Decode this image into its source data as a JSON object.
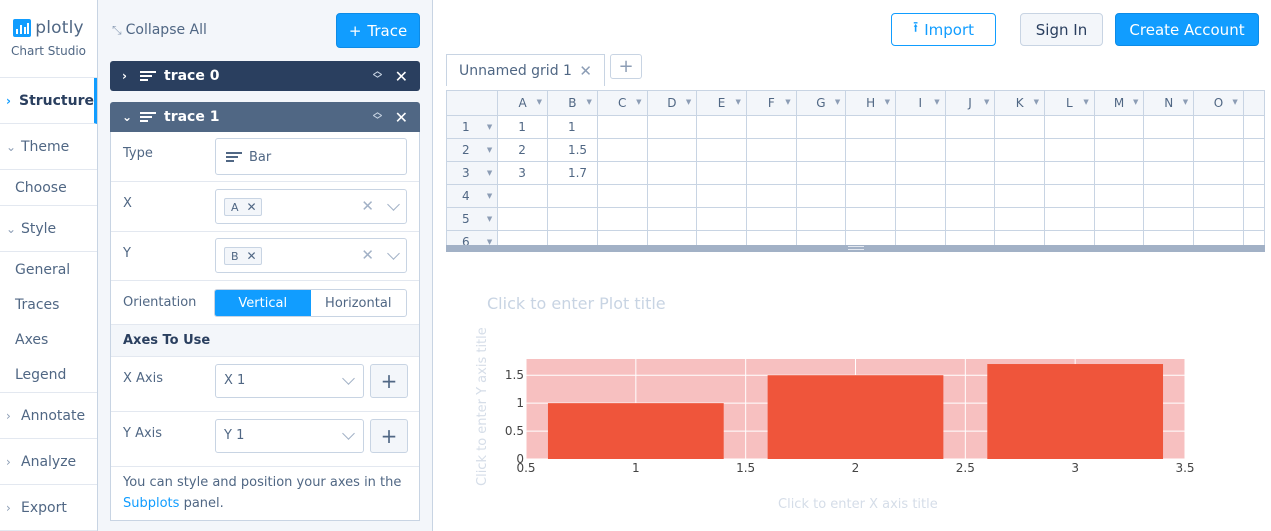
{
  "app": {
    "logo_text": "plotly",
    "logo_sub": "Chart Studio"
  },
  "sidebar": {
    "sections": [
      {
        "label": "Structure",
        "chevron": "›",
        "active": true
      },
      {
        "label": "Theme",
        "chevron": "⌄",
        "sub": [
          "Choose"
        ]
      },
      {
        "label": "Style",
        "chevron": "⌄",
        "sub": [
          "General",
          "Traces",
          "Axes",
          "Legend"
        ]
      },
      {
        "label": "Annotate",
        "chevron": "›"
      },
      {
        "label": "Analyze",
        "chevron": "›"
      },
      {
        "label": "Export",
        "chevron": "›"
      }
    ]
  },
  "panel": {
    "collapse_all": "Collapse All",
    "add_trace": "Trace",
    "trace0": {
      "name": "trace 0"
    },
    "trace1": {
      "name": "trace 1",
      "type_label": "Type",
      "type_value": "Bar",
      "x_label": "X",
      "x_chip": "A",
      "y_label": "Y",
      "y_chip": "B",
      "orientation_label": "Orientation",
      "orientation_options": [
        "Vertical",
        "Horizontal"
      ],
      "orientation_selected": "Vertical",
      "axes_section": "Axes To Use",
      "x_axis_label": "X Axis",
      "x_axis_value": "X 1",
      "y_axis_label": "Y Axis",
      "y_axis_value": "Y 1",
      "help_prefix": "You can style and position your axes in the",
      "help_link": "Subplots",
      "help_suffix": "panel."
    }
  },
  "topbar": {
    "import": "Import",
    "sign_in": "Sign In",
    "create_account": "Create Account"
  },
  "grid": {
    "tab_name": "Unnamed grid 1",
    "columns": [
      "A",
      "B",
      "C",
      "D",
      "E",
      "F",
      "G",
      "H",
      "I",
      "J",
      "K",
      "L",
      "M",
      "N",
      "O"
    ],
    "rows": [
      {
        "n": "1",
        "cells": [
          "1",
          "1"
        ]
      },
      {
        "n": "2",
        "cells": [
          "2",
          "1.5"
        ]
      },
      {
        "n": "3",
        "cells": [
          "3",
          "1.7"
        ]
      },
      {
        "n": "4",
        "cells": []
      },
      {
        "n": "5",
        "cells": []
      },
      {
        "n": "6",
        "cells": []
      }
    ]
  },
  "plot": {
    "title_placeholder": "Click to enter Plot title",
    "x_title_placeholder": "Click to enter X axis title",
    "y_title_placeholder": "Click to enter Y axis title"
  },
  "chart_data": {
    "type": "bar",
    "x": [
      1,
      2,
      3
    ],
    "values": [
      1,
      1.5,
      1.7
    ],
    "xlim": [
      0.5,
      3.5
    ],
    "ylim": [
      0,
      1.79
    ],
    "x_ticks": [
      "0.5",
      "1",
      "1.5",
      "2",
      "2.5",
      "3",
      "3.5"
    ],
    "y_ticks": [
      "0",
      "0.5",
      "1",
      "1.5"
    ],
    "bar_color": "#ef553b",
    "plot_bg": "#f7c0c0",
    "grid": true
  }
}
